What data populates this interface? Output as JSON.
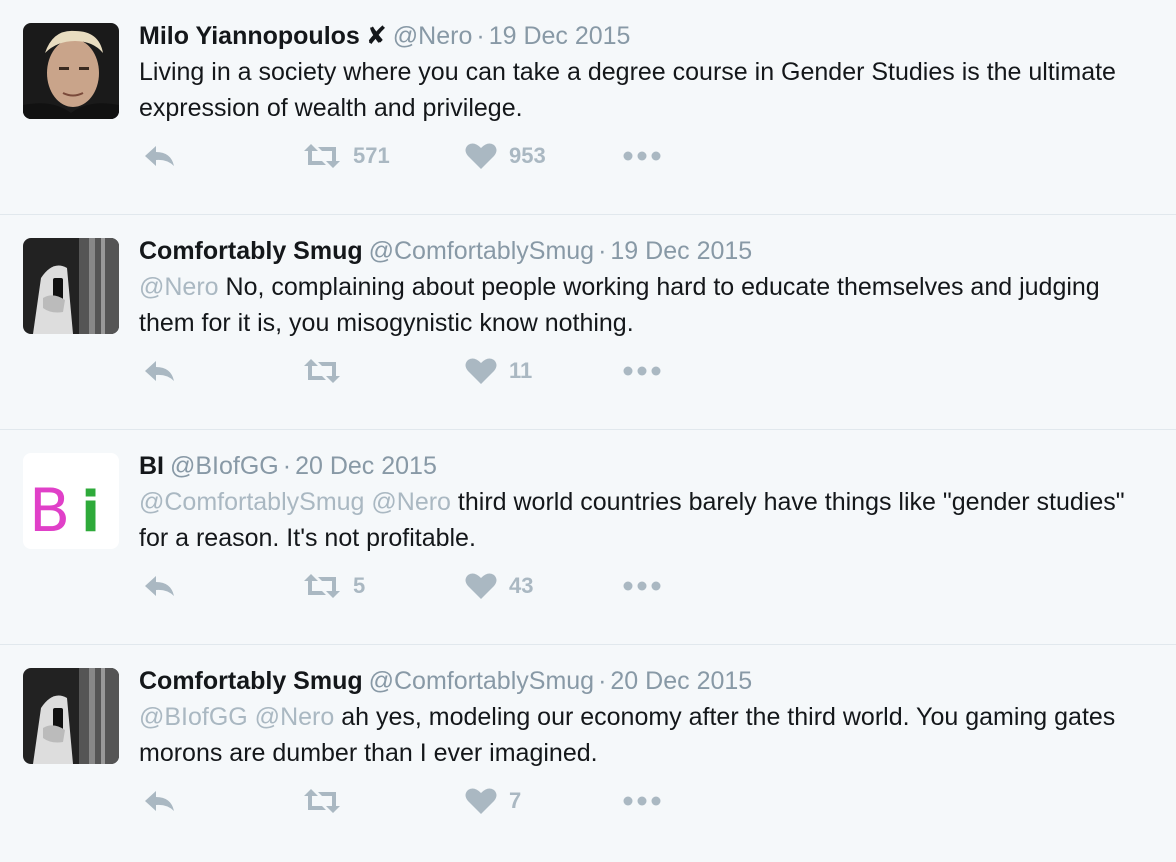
{
  "tweets": [
    {
      "name": "Milo Yiannopoulos",
      "verified_mark": "✘",
      "handle": "@Nero",
      "date": "19 Dec 2015",
      "mentions": "",
      "text": "Living in a society where you can take a degree course in Gender Studies is the ultimate expression of wealth and privilege.",
      "retweets": "571",
      "likes": "953",
      "avatar_icon": "milo-photo"
    },
    {
      "name": "Comfortably Smug",
      "verified_mark": "",
      "handle": "@ComfortablySmug",
      "date": "19 Dec 2015",
      "mentions": "@Nero",
      "text": "No, complaining about people working hard to educate themselves and judging them for it is, you misogynistic know nothing.",
      "retweets": "",
      "likes": "11",
      "avatar_icon": "bw-mirror-photo"
    },
    {
      "name": "BI",
      "verified_mark": "",
      "handle": "@BIofGG",
      "date": "20 Dec 2015",
      "mentions": "@ComfortablySmug @Nero",
      "text": "third world countries barely have things like \"gender studies\" for a reason. It's not profitable.",
      "retweets": "5",
      "likes": "43",
      "avatar_icon": "bi-logo"
    },
    {
      "name": "Comfortably Smug",
      "verified_mark": "",
      "handle": "@ComfortablySmug",
      "date": "20 Dec 2015",
      "mentions": "@BIofGG @Nero",
      "text": "ah yes, modeling our economy after the third world. You gaming gates morons are dumber than I ever imagined.",
      "retweets": "",
      "likes": "7",
      "avatar_icon": "bw-mirror-photo"
    }
  ],
  "separator": "·",
  "colors": {
    "background": "#f5f8fa",
    "muted": "#8899a6",
    "icon": "#aab8c2",
    "text": "#14171a",
    "bi_pink": "#e040c8",
    "bi_green": "#2eaa3a"
  },
  "logo_text": {
    "bi_b": "B",
    "bi_i": "i"
  }
}
